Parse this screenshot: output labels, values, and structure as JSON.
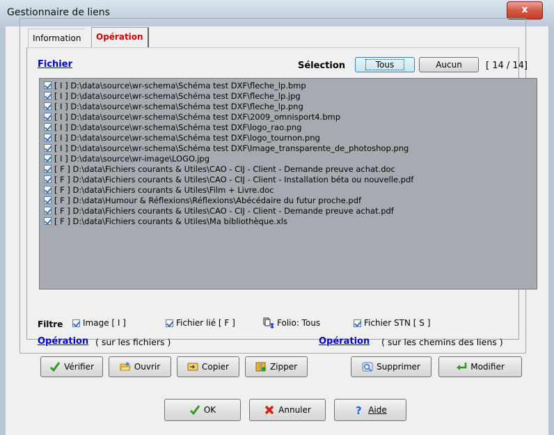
{
  "window": {
    "title": "Gestionnaire de liens",
    "close_label": "x"
  },
  "tabs": [
    {
      "label": "Information"
    },
    {
      "label": "Opération"
    }
  ],
  "header": {
    "fichier_label": "Fichier",
    "selection_label": "Sélection",
    "tous_label": "Tous",
    "aucun_label": "Aucun",
    "count": "[ 14 / 14]"
  },
  "files": [
    "[ I ] D:\\data\\source\\wr-schema\\Schéma test DXF\\fleche_lp.bmp",
    "[ I ] D:\\data\\source\\wr-schema\\Schéma test DXF\\fleche_lp.jpg",
    "[ I ] D:\\data\\source\\wr-schema\\Schéma test DXF\\fleche_lp.png",
    "[ I ] D:\\data\\source\\wr-schema\\Schéma test DXF\\2009_omnisport4.bmp",
    "[ I ] D:\\data\\source\\wr-schema\\Schéma test DXF\\logo_rao.png",
    "[ I ] D:\\data\\source\\wr-schema\\Schéma test DXF\\logo_tournon.png",
    "[ I ] D:\\data\\source\\wr-schema\\Schéma test DXF\\Image_transparente_de_photoshop.png",
    "[ I ] D:\\data\\source\\wr-image\\LOGO.jpg",
    "[ F ] D:\\data\\Fichiers courants & Utiles\\CAO - CIJ - Client - Demande preuve achat.doc",
    "[ F ] D:\\data\\Fichiers courants & Utiles\\CAO - CIJ - Client - Installation béta ou nouvelle.pdf",
    "[ F ] D:\\data\\Fichiers courants & Utiles\\Film + Livre.doc",
    "[ F ] D:\\data\\Humour & Réflexions\\Réflexions\\Abécédaire du futur proche.pdf",
    "[ F ] D:\\data\\Fichiers courants & Utiles\\CAO - CIJ - Client - Demande preuve achat.pdf",
    "[ F ] D:\\data\\Fichiers courants & Utiles\\Ma bibliothèque.xls"
  ],
  "filters": {
    "label": "Filtre",
    "image": "Image [ I ]",
    "fichier_lie": "Fichier lié [ F ]",
    "folio": "Folio: Tous",
    "stn": "Fichier STN [ S ]"
  },
  "operations": {
    "files_link": "Opération",
    "files_note": "( sur les fichiers )",
    "paths_link": "Opération",
    "paths_note": "( sur les chemins des liens )"
  },
  "buttons": {
    "verifier": "Vérifier",
    "ouvrir": "Ouvrir",
    "copier": "Copier",
    "zipper": "Zipper",
    "supprimer": "Supprimer",
    "modifier": "Modifier",
    "ok": "OK",
    "annuler": "Annuler",
    "aide": "Aide"
  },
  "colors": {
    "accent_tab": "#d10000",
    "link": "#0000cc",
    "list_bg": "#a6abb2"
  }
}
